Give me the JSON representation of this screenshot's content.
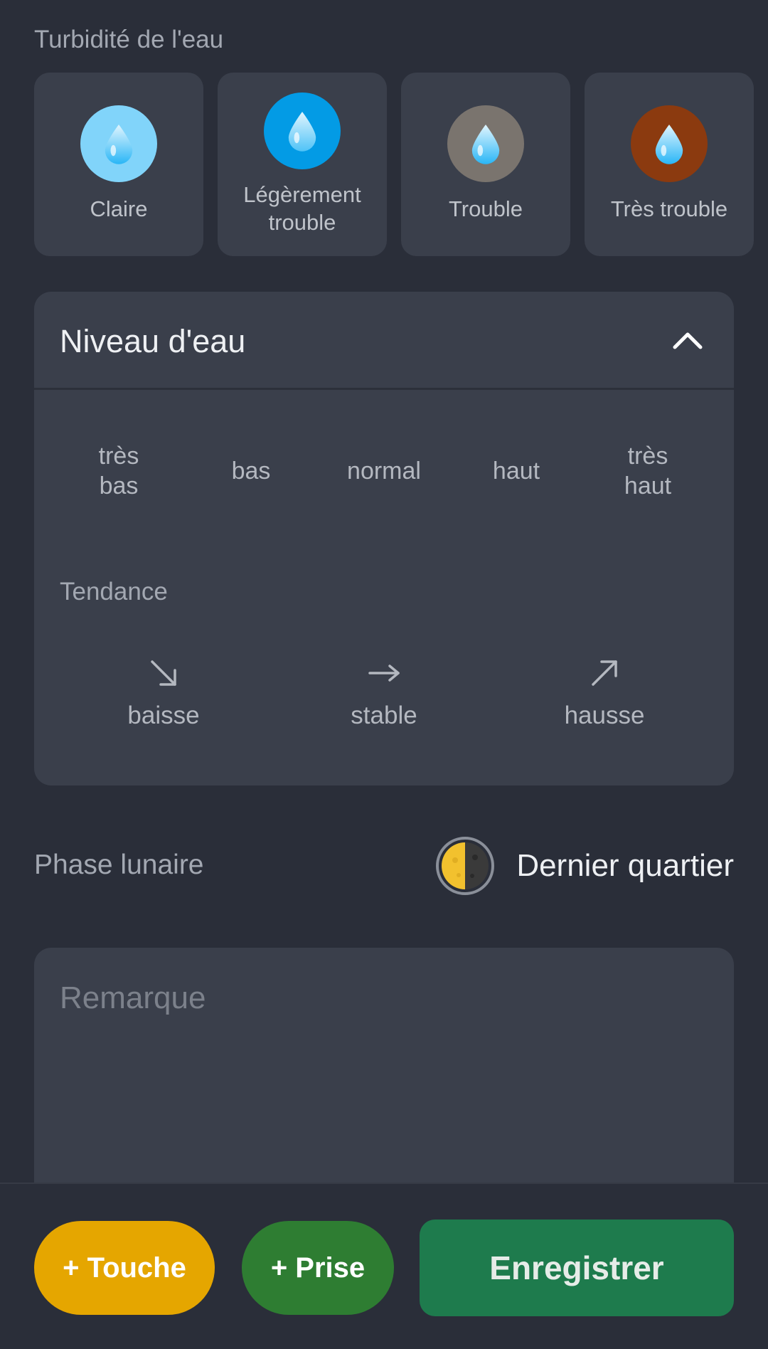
{
  "turbidity": {
    "section_label": "Turbidité de l'eau",
    "options": [
      {
        "label": "Claire",
        "color": "#81d4fa",
        "icon": "water-drop-icon"
      },
      {
        "label": "Légèrement trouble",
        "line1": "Légèrement",
        "line2": "trouble",
        "color": "#039be5",
        "icon": "water-drop-icon"
      },
      {
        "label": "Trouble",
        "color": "#7a746e",
        "icon": "water-drop-icon"
      },
      {
        "label": "Très trouble",
        "color": "#8b3a0f",
        "icon": "water-drop-icon"
      }
    ]
  },
  "water_level": {
    "title": "Niveau d'eau",
    "expanded": true,
    "toggle_icon": "chevron-up-icon",
    "levels": [
      {
        "label": "très bas",
        "line1": "très",
        "line2": "bas"
      },
      {
        "label": "bas"
      },
      {
        "label": "normal"
      },
      {
        "label": "haut"
      },
      {
        "label": "très haut",
        "line1": "très",
        "line2": "haut"
      }
    ],
    "trend_label": "Tendance",
    "trends": [
      {
        "label": "baisse",
        "icon": "arrow-down-right-icon"
      },
      {
        "label": "stable",
        "icon": "arrow-right-icon"
      },
      {
        "label": "hausse",
        "icon": "arrow-up-right-icon"
      }
    ]
  },
  "moon": {
    "label": "Phase lunaire",
    "value": "Dernier quartier",
    "icon": "last-quarter-moon-icon"
  },
  "remark": {
    "placeholder": "Remarque",
    "value": ""
  },
  "actions": {
    "touche_label": "+ Touche",
    "touche_color": "#e5a600",
    "prise_label": "+ Prise",
    "prise_color": "#2e7d32",
    "save_label": "Enregistrer",
    "save_color": "#1e7b4d"
  }
}
